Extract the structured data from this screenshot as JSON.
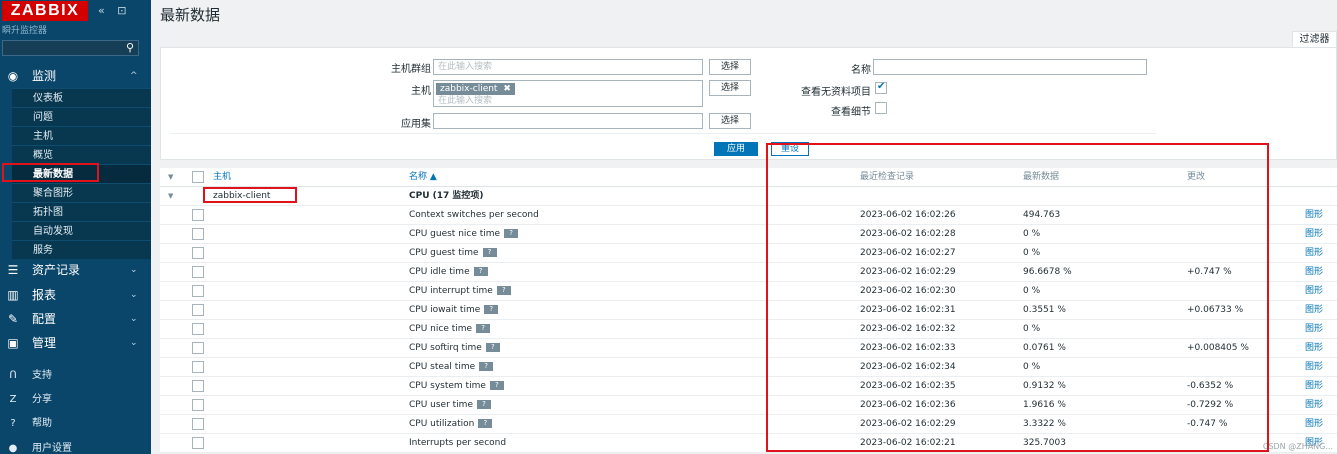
{
  "sidebar": {
    "logo": "ZABBIX",
    "collapse_icon": "«",
    "kiosk_icon": "⊡",
    "server_name": "瞬升监控器",
    "search_icon": "⚲",
    "sections": [
      {
        "icon": "eye-icon",
        "glyph": "◉",
        "label": "监测",
        "chevron": "^"
      },
      {
        "icon": "list-icon",
        "glyph": "☰",
        "label": "资产记录",
        "chevron": "⌄"
      },
      {
        "icon": "chart-icon",
        "glyph": "▥",
        "label": "报表",
        "chevron": "⌄"
      },
      {
        "icon": "wrench-icon",
        "glyph": "✎",
        "label": "配置",
        "chevron": "⌄"
      },
      {
        "icon": "gear-icon",
        "glyph": "▣",
        "label": "管理",
        "chevron": "⌄"
      }
    ],
    "monitor_items": [
      "仪表板",
      "问题",
      "主机",
      "概览",
      "最新数据",
      "聚合图形",
      "拓扑图",
      "自动发现",
      "服务"
    ],
    "footer": [
      {
        "icon": "support-icon",
        "glyph": "ᑎ",
        "label": "支持"
      },
      {
        "icon": "share-icon",
        "glyph": "Z",
        "label": "分享"
      },
      {
        "icon": "help-icon",
        "glyph": "?",
        "label": "帮助"
      },
      {
        "icon": "user-icon",
        "glyph": "●",
        "label": "用户设置"
      }
    ]
  },
  "page": {
    "title": "最新数据",
    "filter_tab": "过滤器"
  },
  "filter": {
    "host_group_label": "主机群组",
    "host_group_placeholder": "在此输入搜索",
    "select_label": "选择",
    "host_label": "主机",
    "host_tag": "zabbix-client",
    "host_tag_remove": "✖",
    "host_placeholder": "在此输入搜索",
    "app_label": "应用集",
    "app_select_label": "选择",
    "name_label": "名称",
    "show_no_data_label": "查看无资料项目",
    "show_details_label": "查看细节",
    "apply_label": "应用",
    "reset_label": "重设"
  },
  "table": {
    "headers": {
      "host": "主机",
      "name": "名称 ▲",
      "last_check": "最近检查记录",
      "last_value": "最新数据",
      "change": "更改"
    },
    "host": "zabbix-client",
    "group": "CPU (17 监控项)",
    "graph_label": "图形",
    "help_glyph": "?",
    "rows": [
      {
        "name": "Context switches per second",
        "help": false,
        "time": "2023-06-02 16:02:26",
        "value": "494.763",
        "change": ""
      },
      {
        "name": "CPU guest nice time",
        "help": true,
        "time": "2023-06-02 16:02:28",
        "value": "0 %",
        "change": ""
      },
      {
        "name": "CPU guest time",
        "help": true,
        "time": "2023-06-02 16:02:27",
        "value": "0 %",
        "change": ""
      },
      {
        "name": "CPU idle time",
        "help": true,
        "time": "2023-06-02 16:02:29",
        "value": "96.6678 %",
        "change": "+0.747 %"
      },
      {
        "name": "CPU interrupt time",
        "help": true,
        "time": "2023-06-02 16:02:30",
        "value": "0 %",
        "change": ""
      },
      {
        "name": "CPU iowait time",
        "help": true,
        "time": "2023-06-02 16:02:31",
        "value": "0.3551 %",
        "change": "+0.06733 %"
      },
      {
        "name": "CPU nice time",
        "help": true,
        "time": "2023-06-02 16:02:32",
        "value": "0 %",
        "change": ""
      },
      {
        "name": "CPU softirq time",
        "help": true,
        "time": "2023-06-02 16:02:33",
        "value": "0.0761 %",
        "change": "+0.008405 %"
      },
      {
        "name": "CPU steal time",
        "help": true,
        "time": "2023-06-02 16:02:34",
        "value": "0 %",
        "change": ""
      },
      {
        "name": "CPU system time",
        "help": true,
        "time": "2023-06-02 16:02:35",
        "value": "0.9132 %",
        "change": "-0.6352 %"
      },
      {
        "name": "CPU user time",
        "help": true,
        "time": "2023-06-02 16:02:36",
        "value": "1.9616 %",
        "change": "-0.7292 %"
      },
      {
        "name": "CPU utilization",
        "help": true,
        "time": "2023-06-02 16:02:29",
        "value": "3.3322 %",
        "change": "-0.747 %"
      },
      {
        "name": "Interrupts per second",
        "help": false,
        "time": "2023-06-02 16:02:21",
        "value": "325.7003",
        "change": ""
      }
    ]
  },
  "watermark": "CSDN @ZHANG..."
}
